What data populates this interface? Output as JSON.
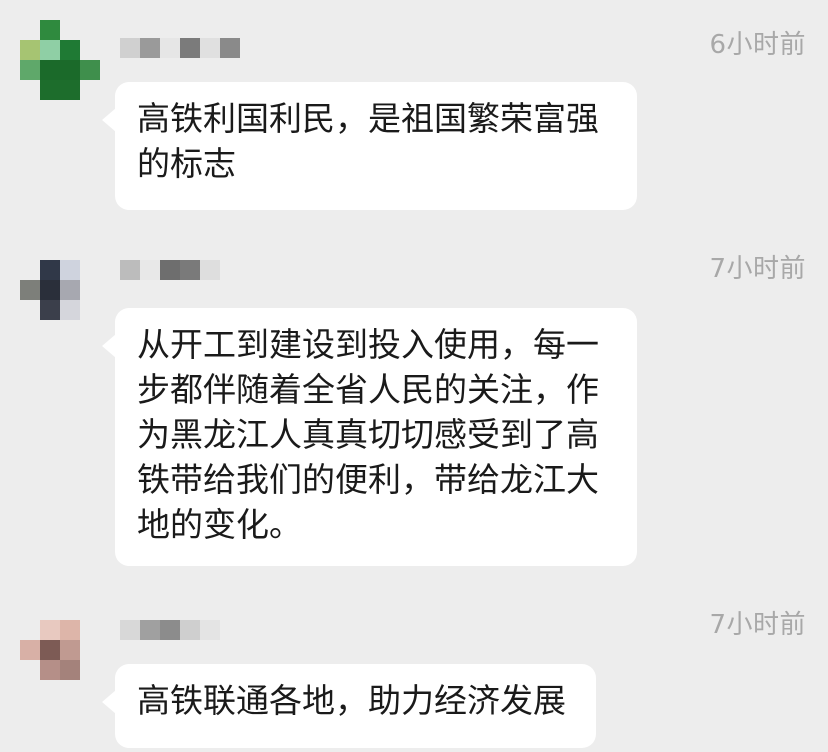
{
  "comments": [
    {
      "text": "高铁利国利民，是祖国繁荣富强的标志",
      "time": "6小时前",
      "avatar_colors": [
        "#ededed",
        "#2f8a3e",
        "#ededed",
        "#ededed",
        "#a6c472",
        "#8fcfa5",
        "#1f7a34",
        "#ededed",
        "#5fa86a",
        "#1b6a2a",
        "#1b6a2a",
        "#3f8f4c",
        "#ededed",
        "#1d6d2c",
        "#1d6d2c",
        "#ededed"
      ],
      "name_colors": [
        "#d0d0d0",
        "#9a9a9a",
        "#e6e6e6",
        "#7b7b7b",
        "#e0e0e0",
        "#8a8a8a"
      ]
    },
    {
      "text": "从开工到建设到投入使用，每一步都伴随着全省人民的关注，作为黑龙江人真真切切感受到了高铁带给我们的便利，带给龙江大地的变化。",
      "time": "7小时前",
      "avatar_colors": [
        "#ededed",
        "#303848",
        "#cfd3de",
        "#ededed",
        "#7d7f7a",
        "#2a2f3a",
        "#a7a8b0",
        "#ededed",
        "#ededed",
        "#3b3f4b",
        "#d5d6dc",
        "#ededed",
        "#ededed",
        "#ededed",
        "#ededed",
        "#ededed"
      ],
      "name_colors": [
        "#bcbcbc",
        "#e8e8e8",
        "#6e6e6e",
        "#7a7a7a",
        "#dedede",
        "#ededed"
      ]
    },
    {
      "text": "高铁联通各地，助力经济发展",
      "time": "7小时前",
      "avatar_colors": [
        "#ededed",
        "#e8c9c0",
        "#ddb5a9",
        "#ededed",
        "#d8b0a6",
        "#7d5b55",
        "#c09a91",
        "#ededed",
        "#ededed",
        "#b58f88",
        "#a4827b",
        "#ededed",
        "#ededed",
        "#ededed",
        "#ededed",
        "#ededed"
      ],
      "name_colors": [
        "#d8d8d8",
        "#a0a0a0",
        "#8c8c8c",
        "#cfcfcf",
        "#e4e4e4",
        "#ededed"
      ]
    }
  ]
}
